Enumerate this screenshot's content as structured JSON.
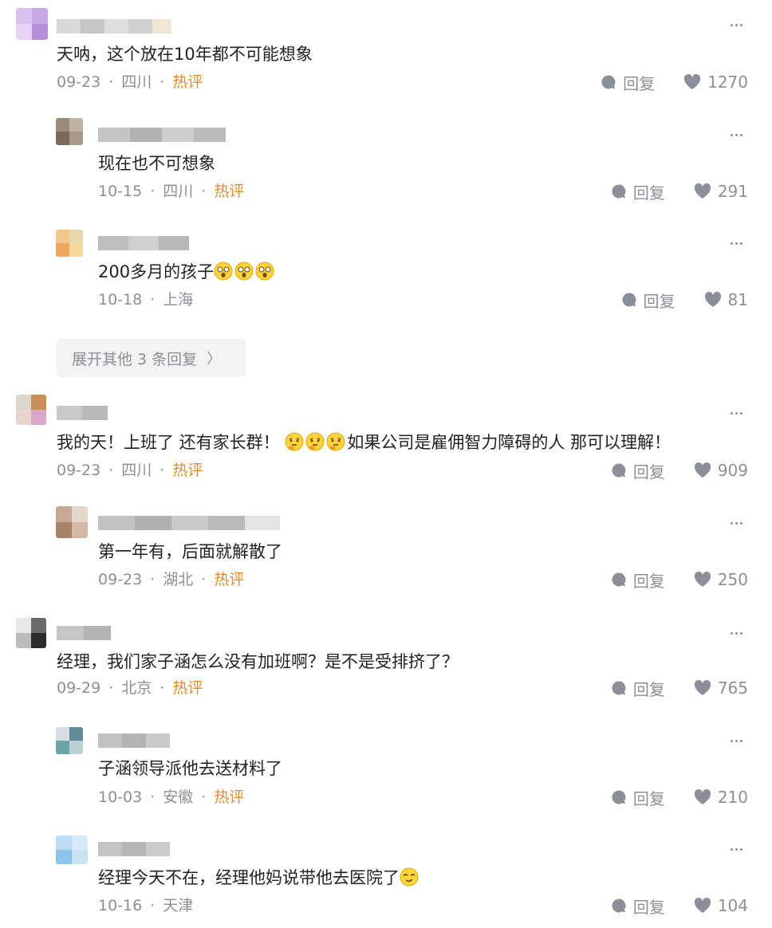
{
  "comments": [
    {
      "text": "天呐，这个放在10年都不可能想象",
      "date": "09-23",
      "location": "四川",
      "hot": "热评",
      "reply": "回复",
      "likes": "1270"
    },
    {
      "text": "现在也不可想象",
      "date": "10-15",
      "location": "四川",
      "hot": "热评",
      "reply": "回复",
      "likes": "291"
    },
    {
      "text": "200多月的孩子",
      "date": "10-18",
      "location": "上海",
      "reply": "回复",
      "likes": "81"
    },
    {
      "text_a": "我的天！上班了 还有家长群！",
      "text_b": "如果公司是雇佣智力障碍的人 那可以理解！",
      "date": "09-23",
      "location": "四川",
      "hot": "热评",
      "reply": "回复",
      "likes": "909"
    },
    {
      "text": "第一年有，后面就解散了",
      "date": "09-23",
      "location": "湖北",
      "hot": "热评",
      "reply": "回复",
      "likes": "250"
    },
    {
      "text": "经理，我们家子涵怎么没有加班啊？是不是受排挤了？",
      "date": "09-29",
      "location": "北京",
      "hot": "热评",
      "reply": "回复",
      "likes": "765"
    },
    {
      "text": "子涵领导派他去送材料了",
      "date": "10-03",
      "location": "安徽",
      "hot": "热评",
      "reply": "回复",
      "likes": "210"
    },
    {
      "text": "经理今天不在，经理他妈说带他去医院了",
      "date": "10-16",
      "location": "天津",
      "reply": "回复",
      "likes": "104"
    }
  ],
  "expand_replies": {
    "label": "展开其他 3 条回复",
    "chevron": "〉"
  },
  "separator": "·",
  "icons": {
    "reply": "reply-bubble-icon",
    "like": "heart-icon",
    "more": "more-dots-icon",
    "emoji_dizzy": "dizzy-face-emoji",
    "emoji_thinking": "thinking-face-emoji",
    "emoji_smirk": "smirk-face-emoji"
  },
  "colors": {
    "meta": "#8a8f99",
    "hot": "#f08a1c",
    "text": "#222222",
    "expand_bg": "#f2f3f5"
  }
}
